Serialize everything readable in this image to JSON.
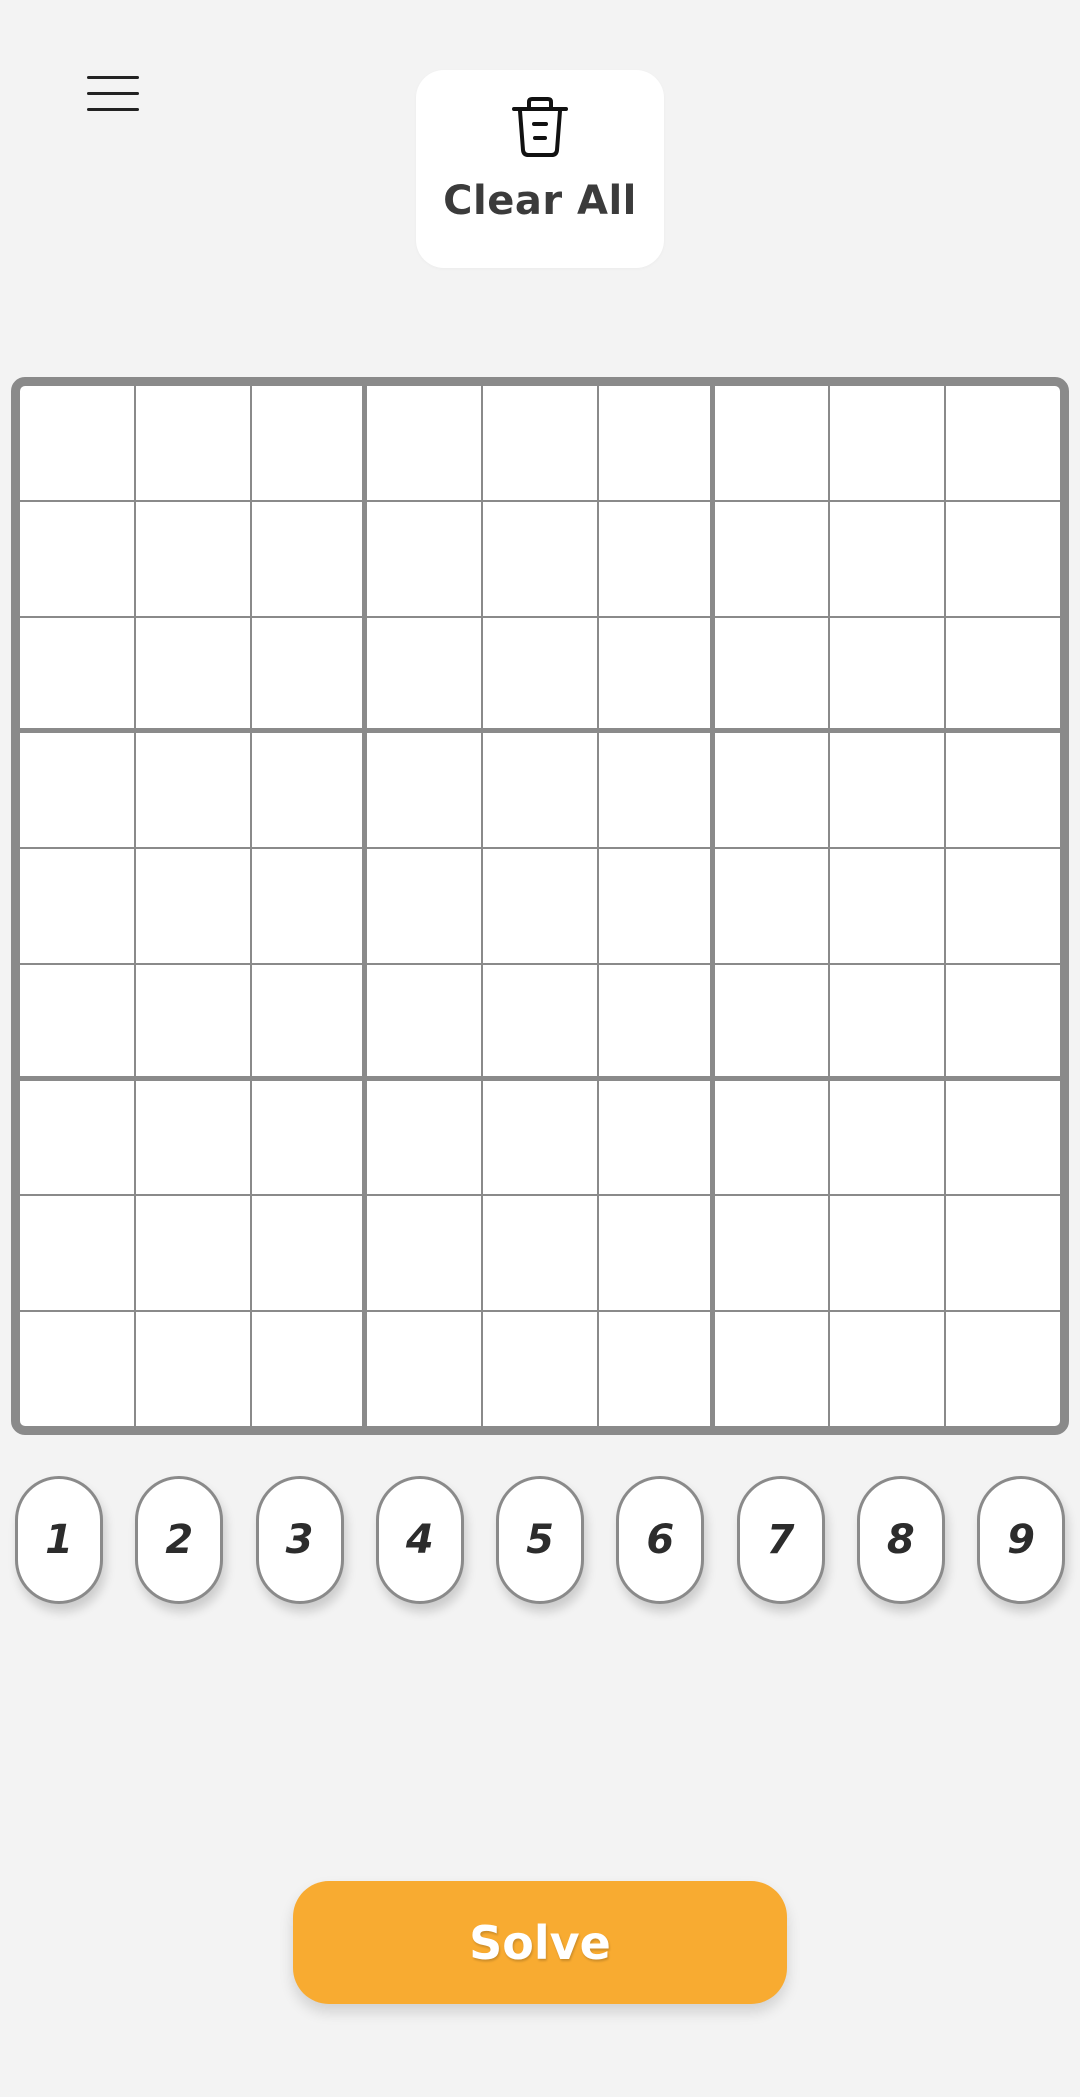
{
  "header": {
    "menu_icon": "hamburger-menu-icon",
    "clear_all": {
      "icon": "trash-icon",
      "label": "Clear All"
    }
  },
  "board": {
    "size": 9,
    "box_size": 3,
    "values": [
      [
        "",
        "",
        "",
        "",
        "",
        "",
        "",
        "",
        ""
      ],
      [
        "",
        "",
        "",
        "",
        "",
        "",
        "",
        "",
        ""
      ],
      [
        "",
        "",
        "",
        "",
        "",
        "",
        "",
        "",
        ""
      ],
      [
        "",
        "",
        "",
        "",
        "",
        "",
        "",
        "",
        ""
      ],
      [
        "",
        "",
        "",
        "",
        "",
        "",
        "",
        "",
        ""
      ],
      [
        "",
        "",
        "",
        "",
        "",
        "",
        "",
        "",
        ""
      ],
      [
        "",
        "",
        "",
        "",
        "",
        "",
        "",
        "",
        ""
      ],
      [
        "",
        "",
        "",
        "",
        "",
        "",
        "",
        "",
        ""
      ],
      [
        "",
        "",
        "",
        "",
        "",
        "",
        "",
        "",
        ""
      ]
    ]
  },
  "numpad": {
    "keys": [
      "1",
      "2",
      "3",
      "4",
      "5",
      "6",
      "7",
      "8",
      "9"
    ]
  },
  "solve_button": {
    "label": "Solve"
  },
  "colors": {
    "background": "#f3f3f3",
    "grid_line": "#8a8a8a",
    "accent": "#f8ab31",
    "text": "#3b3b3b"
  }
}
